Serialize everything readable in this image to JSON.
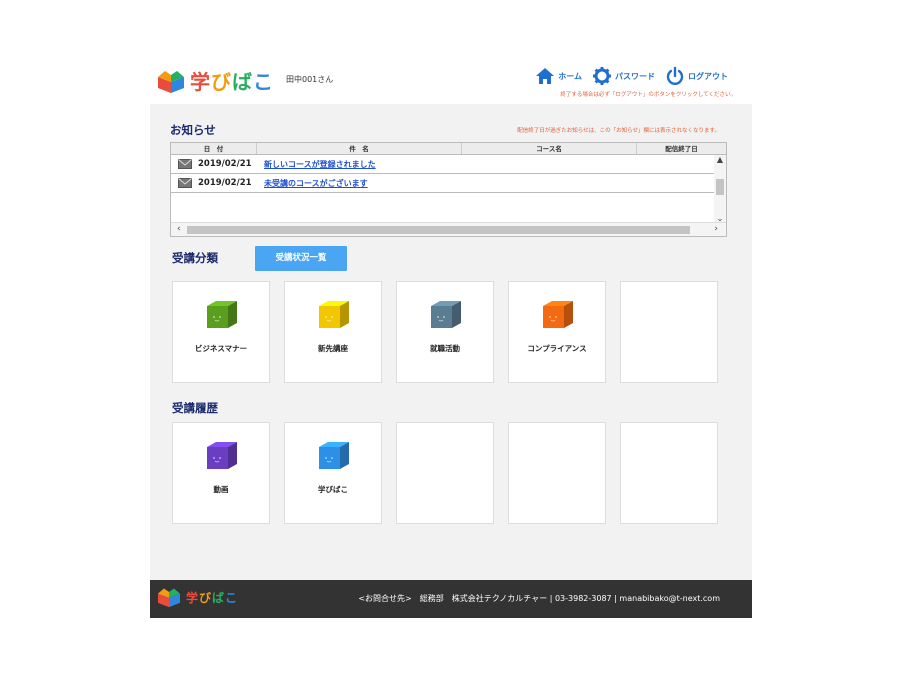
{
  "header": {
    "app_name": "学びばこ",
    "username": "田中001さん",
    "nav": {
      "home": "ホーム",
      "password": "パスワード",
      "logout": "ログアウト"
    },
    "logout_note": "終了する場合は必ず「ログアウト」のボタンをクリックしてください。"
  },
  "notice": {
    "title": "お知らせ",
    "note": "配信終了日が過ぎたお知らせは、この「お知らせ」欄には表示されなくなります。",
    "columns": [
      "日　付",
      "件　名",
      "コース名",
      "配信終了日"
    ],
    "rows": [
      {
        "date": "2019/02/21",
        "title": "新しいコースが登録されました"
      },
      {
        "date": "2019/02/21",
        "title": "未受講のコースがございます"
      }
    ]
  },
  "categories": {
    "title": "受講分類",
    "status_button": "受講状況一覧",
    "items": [
      {
        "label": "ビジネスマナー",
        "color": "#5a9e1e"
      },
      {
        "label": "新先講座",
        "color": "#f2c700"
      },
      {
        "label": "就職活動",
        "color": "#5b7d92"
      },
      {
        "label": "コンプライアンス",
        "color": "#f26a11"
      }
    ]
  },
  "history": {
    "title": "受講履歴",
    "items": [
      {
        "label": "動画",
        "color": "#6a3ec2"
      },
      {
        "label": "学びばこ",
        "color": "#2e8fe6"
      }
    ]
  },
  "footer": {
    "contact": "<お問合せ先>　総務部　株式会社テクノカルチャー | 03-3982-3087 | manabibako@t-next.com"
  }
}
